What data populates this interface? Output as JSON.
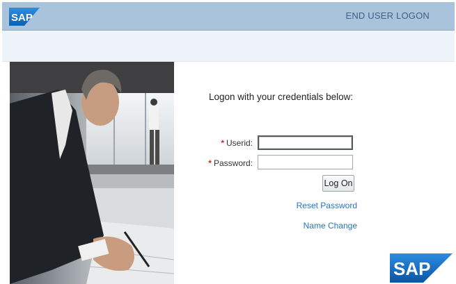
{
  "header": {
    "logo_text": "SAP",
    "title": "END USER LOGON"
  },
  "login": {
    "intro": "Logon with your credentials below:",
    "userid_label": "Userid:",
    "userid_value": "",
    "password_label": "Password:",
    "password_value": "",
    "required_marker": "*",
    "logon_button": "Log On",
    "reset_password_link": "Reset Password",
    "name_change_link": "Name Change"
  },
  "footer": {
    "logo_text": "SAP"
  },
  "colors": {
    "header_bg": "#a9c3dd",
    "header_title": "#3f5f84",
    "link": "#2a73b8",
    "required": "#b8312b",
    "sap_blue": "#1a70c7"
  }
}
